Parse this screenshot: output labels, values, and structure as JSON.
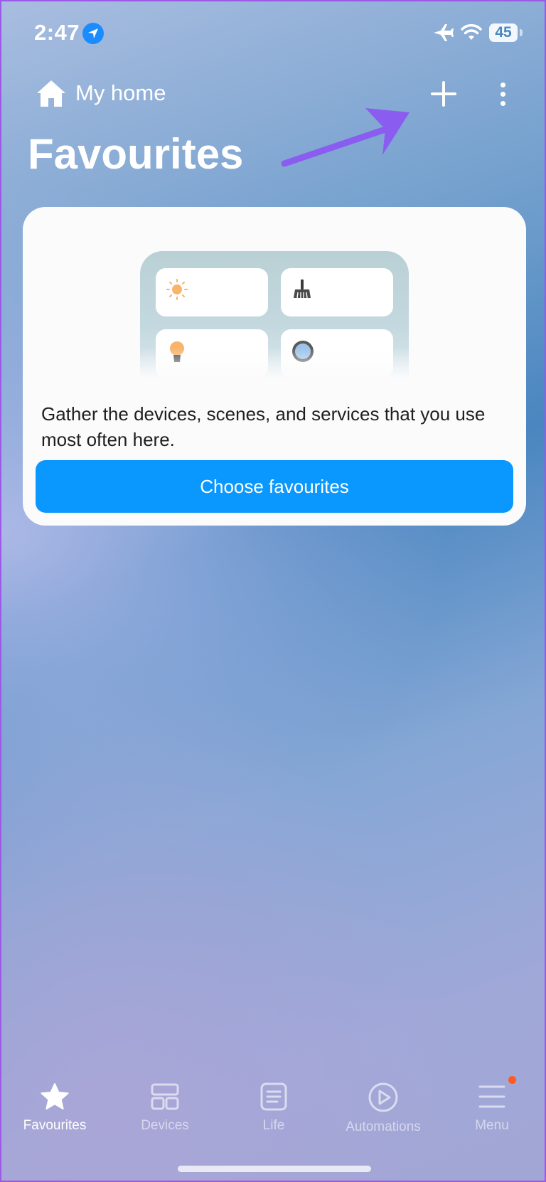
{
  "status_bar": {
    "time": "2:47",
    "battery": "45",
    "icons": [
      "location-arrow-icon",
      "airplane-icon",
      "wifi-icon",
      "battery-icon"
    ]
  },
  "header": {
    "home_label": "My home",
    "home_icon": "house-icon",
    "add_icon": "plus-icon",
    "more_icon": "vertical-ellipsis-icon",
    "title": "Favourites"
  },
  "empty_card": {
    "illustration_icons": [
      "sun-icon",
      "broom-icon",
      "bulb-icon",
      "robot-vacuum-icon"
    ],
    "message": "Gather the devices, scenes, and services that you use most often here.",
    "button_label": "Choose favourites",
    "button_color": "#0a98ff"
  },
  "bottom_nav": {
    "items": [
      {
        "label": "Favourites",
        "icon": "star-icon",
        "active": true
      },
      {
        "label": "Devices",
        "icon": "grid-icon",
        "active": false
      },
      {
        "label": "Life",
        "icon": "document-icon",
        "active": false
      },
      {
        "label": "Automations",
        "icon": "play-circle-icon",
        "active": false
      },
      {
        "label": "Menu",
        "icon": "hamburger-icon",
        "active": false,
        "badge": true
      }
    ]
  },
  "colors": {
    "annotation_arrow": "#8a5cf0",
    "badge": "#ff5a1f"
  }
}
